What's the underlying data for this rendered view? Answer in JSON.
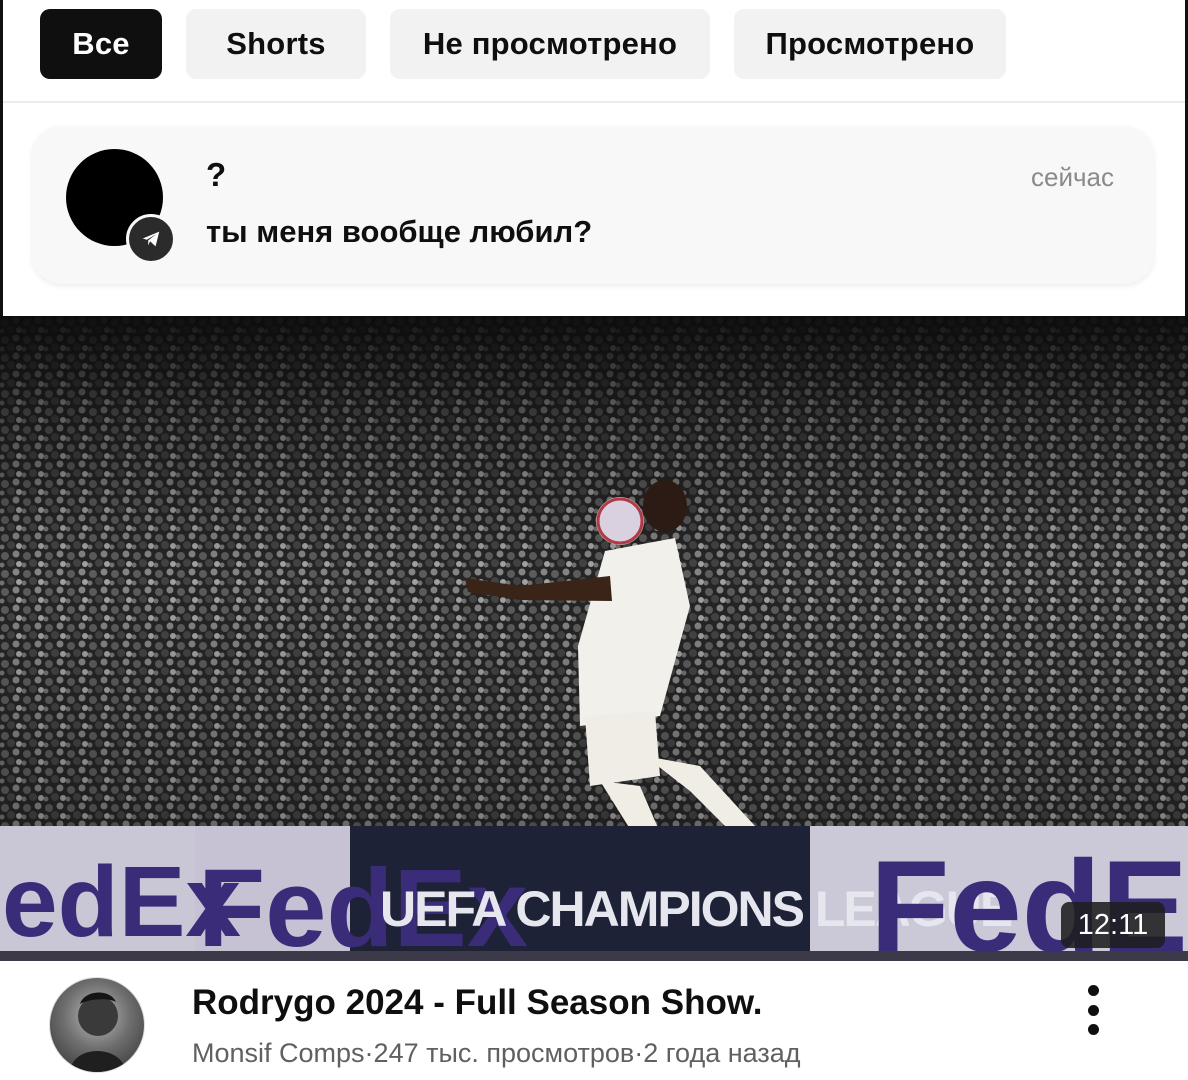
{
  "filters": {
    "chips": [
      {
        "label": "Все",
        "active": true
      },
      {
        "label": "Shorts",
        "active": false
      },
      {
        "label": "Не просмотрено",
        "active": false
      },
      {
        "label": "Просмотрено",
        "active": false
      }
    ]
  },
  "notification": {
    "title": "?",
    "text": "ты меня вообще любил?",
    "time": "сейчас",
    "badge_icon": "telegram-icon"
  },
  "video": {
    "duration": "12:11",
    "title": "Rodrygo 2024 - Full Season Show.",
    "channel": "Monsif Comps",
    "separator": " · ",
    "views": "247 тыс. просмотров",
    "age": "2 года назад",
    "thumbnail": {
      "boards": [
        "edEx",
        "FedEx",
        "UEFA CHAMPIONS LEAGUE",
        "FedEx"
      ]
    }
  },
  "colors": {
    "chip_active_bg": "#0f0f0f",
    "chip_bg": "#f2f2f2",
    "secondary_text": "#606060"
  }
}
